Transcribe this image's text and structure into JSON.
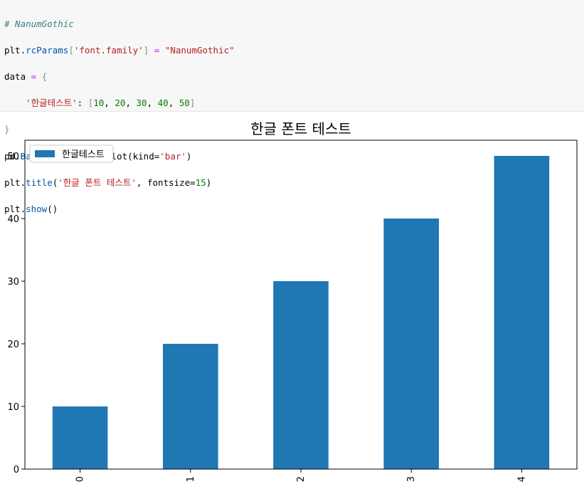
{
  "code": {
    "comment": "# NanumGothic",
    "line2": {
      "obj": "plt",
      "dot": ".",
      "attr": "rcParams",
      "open": "[",
      "key": "'font.family'",
      "close": "]",
      "eq": " = ",
      "val": "\"NanumGothic\""
    },
    "line3": {
      "name": "data",
      "eq": " = ",
      "brace": "{"
    },
    "line4": {
      "indent": "    ",
      "key": "'한글테스트'",
      "colon": ": ",
      "open": "[",
      "n1": "10",
      "n2": "20",
      "n3": "30",
      "n4": "40",
      "n5": "50",
      "sep": ", ",
      "close": "]"
    },
    "line5": {
      "brace": "}"
    },
    "line6": {
      "obj": "pd",
      "dot": ".",
      "fn": "DataFrame",
      "args": "(data).plot(kind=",
      "str": "'bar'",
      "end": ")"
    },
    "line7": {
      "obj": "plt",
      "dot": ".",
      "fn": "title",
      "open": "(",
      "str": "'한글 폰트 테스트'",
      "mid": ", fontsize=",
      "num": "15",
      "end": ")"
    },
    "line8": {
      "obj": "plt",
      "dot": ".",
      "fn": "show",
      "end": "()"
    }
  },
  "chart_data": {
    "type": "bar",
    "title": "한글 폰트 테스트",
    "categories": [
      "0",
      "1",
      "2",
      "3",
      "4"
    ],
    "series": [
      {
        "name": "한글테스트",
        "values": [
          10,
          20,
          30,
          40,
          50
        ],
        "color": "#1f77b4"
      }
    ],
    "ylim": [
      0,
      52.5
    ],
    "yticks": [
      "0",
      "10",
      "20",
      "30",
      "40",
      "50"
    ],
    "xlabel": "",
    "ylabel": "",
    "legend": "top-left",
    "grid": false
  }
}
